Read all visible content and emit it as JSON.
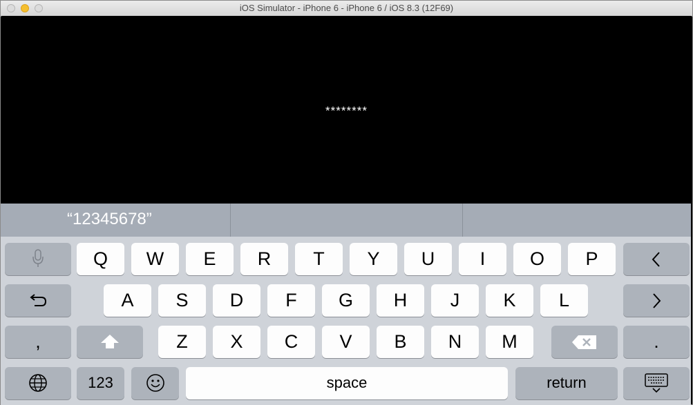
{
  "window": {
    "title": "iOS Simulator - iPhone 6 - iPhone 6 / iOS 8.3 (12F69)"
  },
  "screen": {
    "password_mask": "********"
  },
  "predictive_bar": {
    "suggestion": "“12345678”",
    "slot2": "",
    "slot3": ""
  },
  "keyboard": {
    "row1": [
      "Q",
      "W",
      "E",
      "R",
      "T",
      "Y",
      "U",
      "I",
      "O",
      "P"
    ],
    "row2": [
      "A",
      "S",
      "D",
      "F",
      "G",
      "H",
      "J",
      "K",
      "L"
    ],
    "row3": [
      "Z",
      "X",
      "C",
      "V",
      "B",
      "N",
      "M"
    ],
    "comma": ",",
    "period": ".",
    "numbers": "123",
    "space": "space",
    "return": "return",
    "icons": {
      "dictation": "microphone-icon",
      "undo": "undo-arrow-icon",
      "prev": "chevron-left-icon",
      "next": "chevron-right-icon",
      "shift": "shift-arrow-icon",
      "delete": "backspace-icon",
      "globe": "globe-icon",
      "emoji": "emoji-icon",
      "dismiss": "keyboard-dismiss-icon"
    }
  },
  "colors": {
    "keyboard_bg": "#cfd3d9",
    "key": "#fdfdfd",
    "func_key": "#adb3bb",
    "predictive_bg": "#a5acb6"
  }
}
